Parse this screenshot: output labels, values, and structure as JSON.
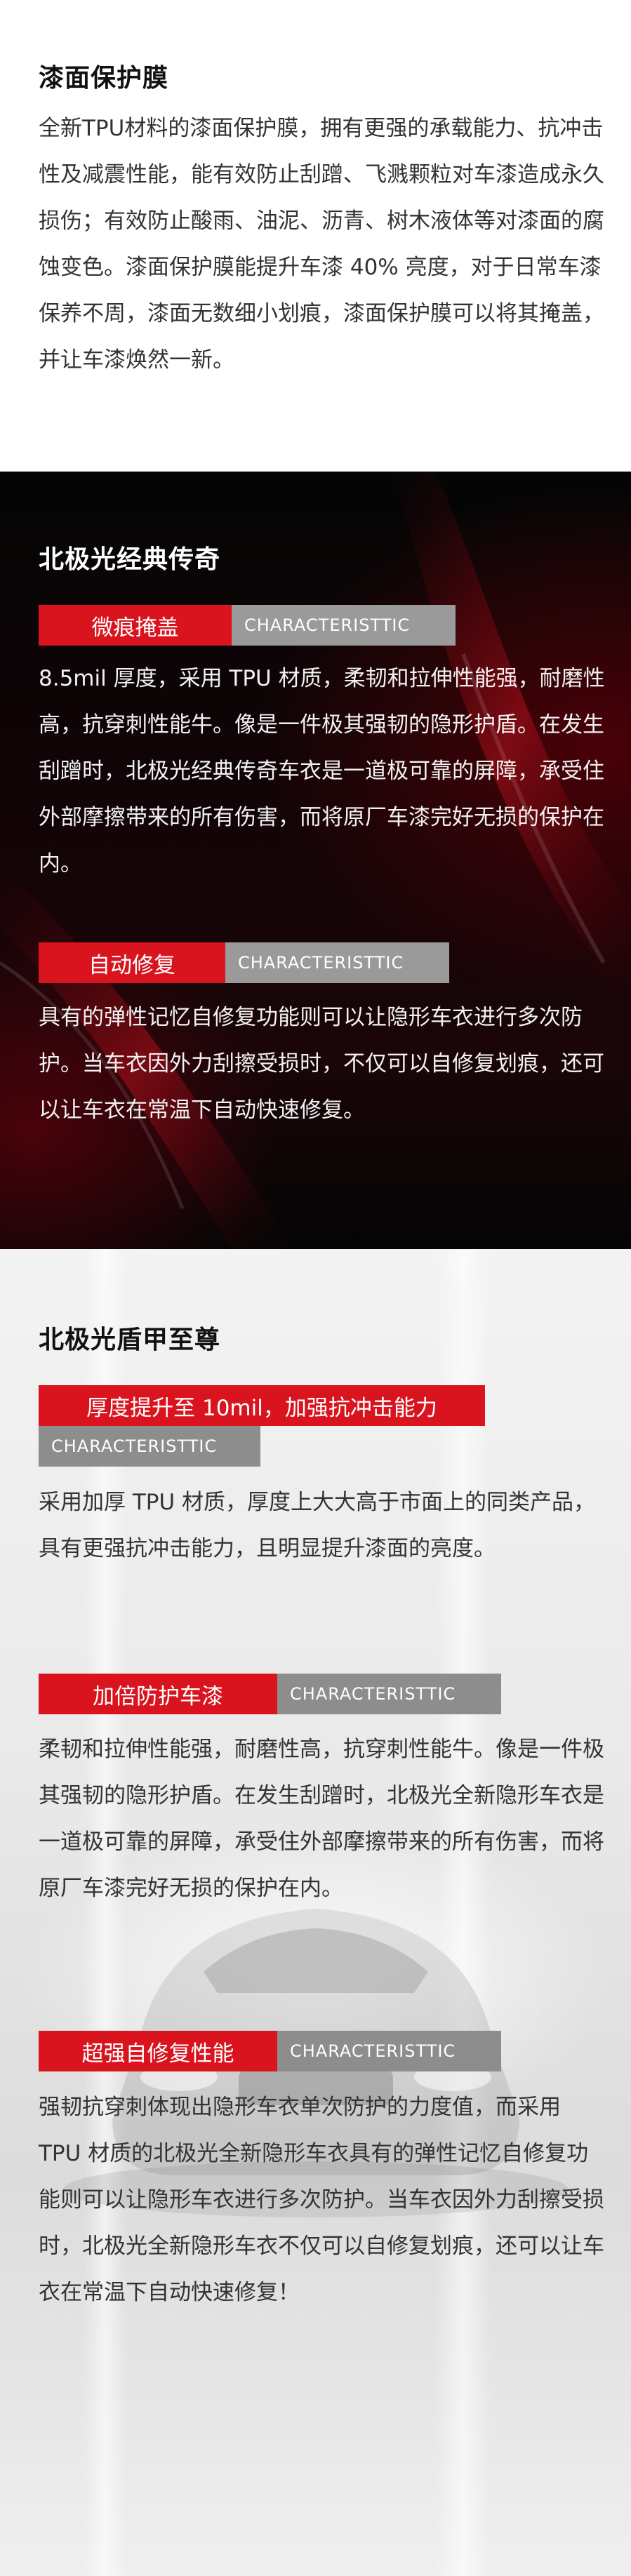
{
  "section1": {
    "title": "漆面保护膜",
    "body": "全新TPU材料的漆面保护膜，拥有更强的承载能力、抗冲击性及减震性能，能有效防止刮蹭、飞溅颗粒对车漆造成永久损伤；有效防止酸雨、油泥、沥青、树木液体等对漆面的腐蚀变色。漆面保护膜能提升车漆 40% 亮度，对于日常车漆保养不周，漆面无数细小划痕，漆面保护膜可以将其掩盖，并让车漆焕然一新。"
  },
  "section2": {
    "title": "北极光经典传奇",
    "features": [
      {
        "tag": "微痕掩盖",
        "tag_en": "CHARACTERISTTIC",
        "body": "8.5mil 厚度，采用 TPU 材质，柔韧和拉伸性能强，耐磨性高，抗穿刺性能牛。像是一件极其强韧的隐形护盾。在发生刮蹭时，北极光经典传奇车衣是一道极可靠的屏障，承受住外部摩擦带来的所有伤害，而将原厂车漆完好无损的保护在内。"
      },
      {
        "tag": "自动修复",
        "tag_en": "CHARACTERISTTIC",
        "body": "具有的弹性记忆自修复功能则可以让隐形车衣进行多次防护。当车衣因外力刮擦受损时，不仅可以自修复划痕，还可以让车衣在常温下自动快速修复。"
      }
    ]
  },
  "section3": {
    "title": "北极光盾甲至尊",
    "features": [
      {
        "tag": "厚度提升至 10mil，加强抗冲击能力",
        "tag_en": "CHARACTERISTTIC",
        "body": "采用加厚 TPU 材质，厚度上大大高于市面上的同类产品，具有更强抗冲击能力，且明显提升漆面的亮度。"
      },
      {
        "tag": "加倍防护车漆",
        "tag_en": "CHARACTERISTTIC",
        "body": "柔韧和拉伸性能强，耐磨性高，抗穿刺性能牛。像是一件极其强韧的隐形护盾。在发生刮蹭时，北极光全新隐形车衣是一道极可靠的屏障，承受住外部摩擦带来的所有伤害，而将原厂车漆完好无损的保护在内。"
      },
      {
        "tag": "超强自修复性能",
        "tag_en": "CHARACTERISTTIC",
        "body": "强韧抗穿刺体现出隐形车衣单次防护的力度值，而采用 TPU 材质的北极光全新隐形车衣具有的弹性记忆自修复功能则可以让隐形车衣进行多次防护。当车衣因外力刮擦受损时，北极光全新隐形车衣不仅可以自修复划痕，还可以让车衣在常温下自动快速修复！"
      }
    ]
  },
  "colors": {
    "accent_red": "#d9141e",
    "tag_gray": "#9a9a9a",
    "dark_bg": "#0a0a0a"
  }
}
